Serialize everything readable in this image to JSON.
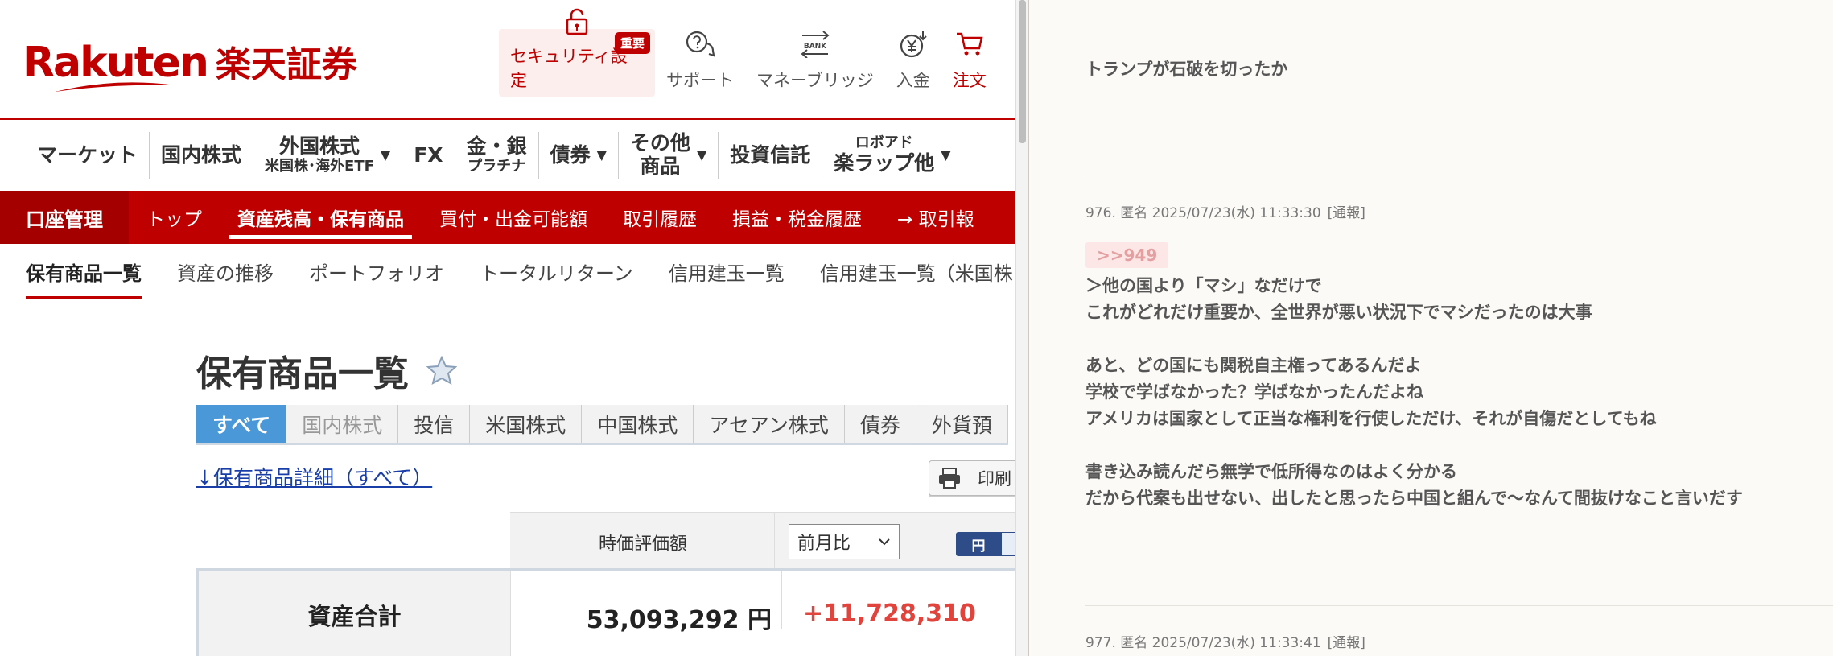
{
  "left": {
    "logo": {
      "en": "Rakuten",
      "jp": "楽天証券"
    },
    "header_icons": [
      {
        "label": "セキュリティ設定",
        "icon": "lock-icon",
        "badge": "重要"
      },
      {
        "label": "サポート",
        "icon": "chat-support-icon"
      },
      {
        "label": "マネーブリッジ",
        "icon": "bank-transfer-icon",
        "icon_text": "BANK"
      },
      {
        "label": "入金",
        "icon": "yen-deposit-icon"
      },
      {
        "label": "注文",
        "icon": "cart-icon"
      }
    ],
    "main_nav": [
      {
        "label": "マーケット"
      },
      {
        "label": "国内株式"
      },
      {
        "label": "外国株式",
        "sub": "米国株･海外ETF",
        "dropdown": true
      },
      {
        "label": "FX"
      },
      {
        "label": "金・銀",
        "sub": "プラチナ"
      },
      {
        "label": "債券",
        "dropdown": true
      },
      {
        "label": "その他",
        "sub": "商品",
        "dropdown": true
      },
      {
        "label": "投資信託"
      },
      {
        "label": "ロボアド",
        "sub": "楽ラップ他",
        "dropdown": true
      }
    ],
    "account_nav": {
      "title": "口座管理",
      "items": [
        "トップ",
        "資産残高・保有商品",
        "買付・出金可能額",
        "取引履歴",
        "損益・税金履歴",
        "→ 取引報"
      ],
      "active_index": 1
    },
    "sub_nav": {
      "items": [
        "保有商品一覧",
        "資産の推移",
        "ポートフォリオ",
        "トータルリターン",
        "信用建玉一覧",
        "信用建玉一覧（米国株"
      ],
      "active_index": 0
    },
    "page_title": "保有商品一覧",
    "filter_tabs": {
      "items": [
        "すべて",
        "国内株式",
        "投信",
        "米国株式",
        "中国株式",
        "アセアン株式",
        "債券",
        "外貨預"
      ],
      "active_index": 0,
      "dim_index": 1
    },
    "detail_link": "↓保有商品詳細（すべて）",
    "print_label": "印刷",
    "table": {
      "col_header": "時価評価額",
      "compare_select": "前月比",
      "currency_toggle": "円",
      "row_label": "資産合計",
      "value": "53,093,292 円",
      "change": "+11,728,310"
    }
  },
  "right": {
    "top_post": "トランプが石破を切ったか",
    "post976": {
      "meta": "976. 匿名 2025/07/23(水) 11:33:30",
      "report": "[通報]",
      "anchor": ">>949",
      "body": "＞他の国より「マシ」なだけで\nこれがどれだけ重要か、全世界が悪い状況下でマシだったのは大事\n\nあと、どの国にも関税自主権ってあるんだよ\n学校で学ばなかった？学ばなかったんだよね\nアメリカは国家として正当な権利を行使しただけ、それが自傷だとしてもね\n\n書き込み読んだら無学で低所得なのはよく分かる\nだから代案も出せない、出したと思ったら中国と組んで〜なんて間抜けなこと言いだす"
    },
    "post977": {
      "meta": "977. 匿名 2025/07/23(水) 11:33:41",
      "report": "[通報]"
    }
  },
  "colors": {
    "brand_red": "#bf0000",
    "tab_blue": "#4a98d8",
    "gain_red": "#e0443c",
    "forum_bg": "#fcfaf6"
  }
}
